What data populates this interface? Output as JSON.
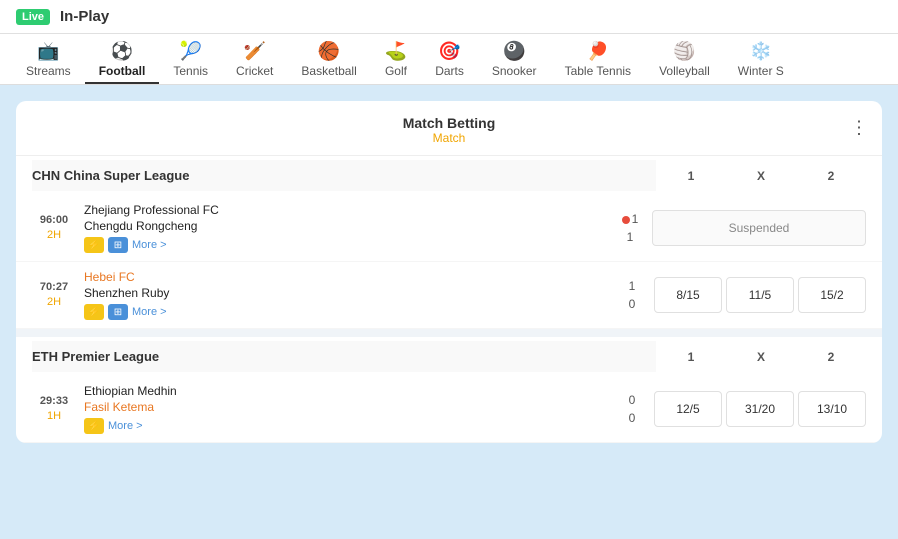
{
  "header": {
    "live_label": "Live",
    "title": "In-Play"
  },
  "nav": {
    "items": [
      {
        "id": "streams",
        "label": "Streams",
        "icon": "📺"
      },
      {
        "id": "football",
        "label": "Football",
        "icon": "⚽",
        "active": true
      },
      {
        "id": "tennis",
        "label": "Tennis",
        "icon": "🎾"
      },
      {
        "id": "cricket",
        "label": "Cricket",
        "icon": "🏏"
      },
      {
        "id": "basketball",
        "label": "Basketball",
        "icon": "🏀"
      },
      {
        "id": "golf",
        "label": "Golf",
        "icon": "⛳"
      },
      {
        "id": "darts",
        "label": "Darts",
        "icon": "🎯"
      },
      {
        "id": "snooker",
        "label": "Snooker",
        "icon": "🎱"
      },
      {
        "id": "table_tennis",
        "label": "Table Tennis",
        "icon": "🏓"
      },
      {
        "id": "volleyball",
        "label": "Volleyball",
        "icon": "🏐"
      },
      {
        "id": "winter",
        "label": "Winter S",
        "icon": "❄️"
      }
    ]
  },
  "card": {
    "title": "Match Betting",
    "subtitle": "Match",
    "col1": "1",
    "colX": "X",
    "col2": "2"
  },
  "leagues": [
    {
      "id": "chn",
      "name": "CHN China Super League",
      "col1": "1",
      "colX": "X",
      "col2": "2",
      "matches": [
        {
          "id": "zhejiang",
          "time": "96:00",
          "period": "2H",
          "team1": "Zhejiang Professional FC",
          "team2": "Chengdu Rongcheng",
          "score1": "1",
          "score2": "1",
          "has_live_dot": true,
          "has_lightning": true,
          "has_grid": true,
          "more": "More >",
          "suspended": true,
          "suspended_label": "Suspended",
          "odds": []
        },
        {
          "id": "hebei",
          "time": "70:27",
          "period": "2H",
          "team1": "Hebei FC",
          "team2": "Shenzhen Ruby",
          "score1": "1",
          "score2": "0",
          "has_live_dot": false,
          "has_lightning": true,
          "has_grid": true,
          "more": "More >",
          "suspended": false,
          "odds": [
            "8/15",
            "11/5",
            "15/2"
          ]
        }
      ]
    },
    {
      "id": "eth",
      "name": "ETH Premier League",
      "col1": "1",
      "colX": "X",
      "col2": "2",
      "matches": [
        {
          "id": "ethiopian",
          "time": "29:33",
          "period": "1H",
          "team1": "Ethiopian Medhin",
          "team2": "Fasil Ketema",
          "score1": "0",
          "score2": "0",
          "has_live_dot": false,
          "has_lightning": true,
          "has_grid": false,
          "more": "More >",
          "suspended": false,
          "odds": [
            "12/5",
            "31/20",
            "13/10"
          ]
        }
      ]
    }
  ]
}
